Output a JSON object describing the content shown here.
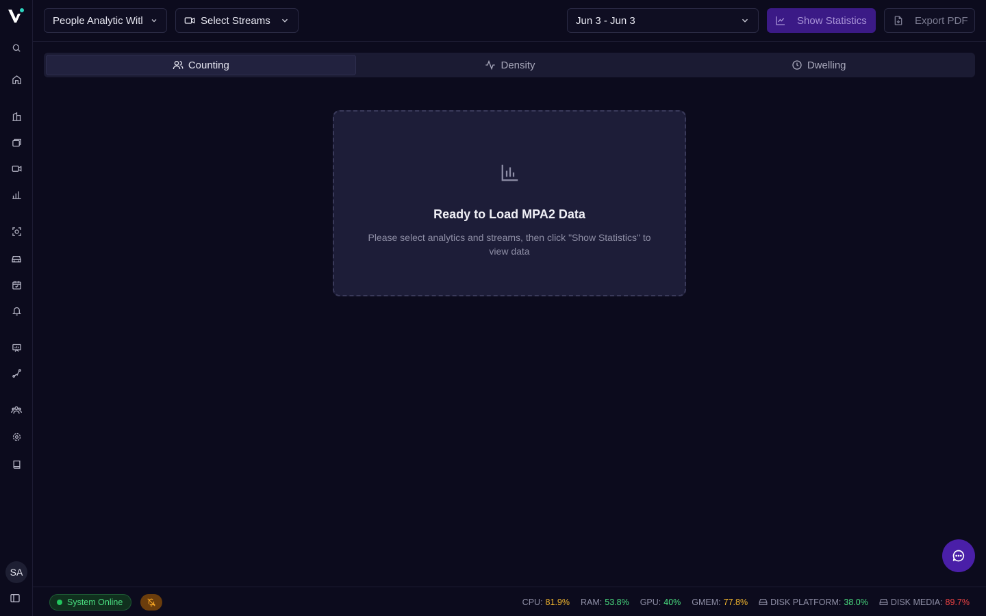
{
  "toolbar": {
    "analytic_select": "People Analytic Witl",
    "streams_select": "Select Streams",
    "date_range": "Jun 3 - Jun 3",
    "show_statistics": "Show Statistics",
    "export_pdf": "Export PDF"
  },
  "tabs": [
    {
      "label": "Counting",
      "icon": "users-icon",
      "active": true
    },
    {
      "label": "Density",
      "icon": "activity-icon",
      "active": false
    },
    {
      "label": "Dwelling",
      "icon": "clock-icon",
      "active": false
    }
  ],
  "empty_state": {
    "icon": "bar-chart-icon",
    "title": "Ready to Load MPA2 Data",
    "description": "Please select analytics and streams, then click \"Show Statistics\" to view data"
  },
  "sidebar": {
    "items": [
      "search-icon",
      "home-icon",
      "building-icon",
      "layers-icon",
      "video-icon",
      "chart-icon",
      "scan-icon",
      "car-icon",
      "calendar-check-icon",
      "bell-icon",
      "presentation-icon",
      "route-icon",
      "team-icon",
      "settings-icon",
      "book-icon"
    ],
    "avatar": "SA"
  },
  "footer": {
    "status": "System Online",
    "metrics": [
      {
        "label": "CPU:",
        "value": "81.9%",
        "color": "#f5b82e"
      },
      {
        "label": "RAM:",
        "value": "53.8%",
        "color": "#4ade80"
      },
      {
        "label": "GPU:",
        "value": "40%",
        "color": "#4ade80"
      },
      {
        "label": "GMEM:",
        "value": "77.8%",
        "color": "#f5b82e"
      },
      {
        "label": "DISK PLATFORM:",
        "value": "38.0%",
        "color": "#4ade80"
      },
      {
        "label": "DISK MEDIA:",
        "value": "89.7%",
        "color": "#f04444"
      }
    ]
  },
  "colors": {
    "background": "#0c0b1d",
    "accent": "#3b1a86",
    "online": "#22c55e"
  }
}
